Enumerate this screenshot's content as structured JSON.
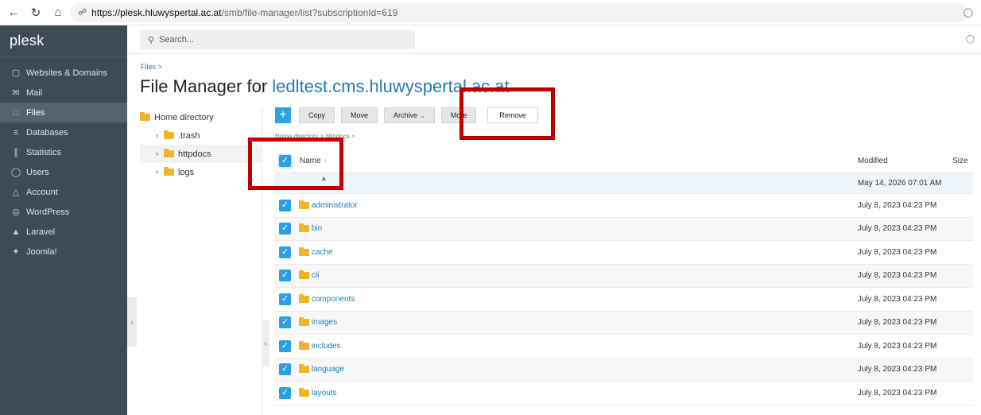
{
  "browser": {
    "url_host": "https://plesk.hluwyspertal.ac.at",
    "url_path": "/smb/file-manager/list?subscriptionId=619"
  },
  "sidebar": {
    "logo": "plesk",
    "items": [
      {
        "label": "Websites & Domains",
        "icon": "monitor-icon"
      },
      {
        "label": "Mail",
        "icon": "mail-icon"
      },
      {
        "label": "Files",
        "icon": "files-icon",
        "active": true
      },
      {
        "label": "Databases",
        "icon": "database-icon"
      },
      {
        "label": "Statistics",
        "icon": "statistics-icon"
      },
      {
        "label": "Users",
        "icon": "users-icon"
      },
      {
        "label": "Account",
        "icon": "account-icon"
      },
      {
        "label": "WordPress",
        "icon": "wordpress-icon"
      },
      {
        "label": "Laravel",
        "icon": "laravel-icon"
      },
      {
        "label": "Joomla!",
        "icon": "joomla-icon"
      }
    ]
  },
  "search": {
    "placeholder": "Search..."
  },
  "breadcrumb": {
    "root": "Files",
    "sep": ">"
  },
  "page": {
    "title_prefix": "File Manager for ",
    "title_domain": "ledltest.cms.hluwyspertal.ac.at"
  },
  "tree": {
    "root": "Home directory",
    "children": [
      ".trash",
      "httpdocs",
      "logs"
    ],
    "selected": "httpdocs"
  },
  "toolbar": {
    "copy": "Copy",
    "move": "Move",
    "archive": "Archive",
    "more": "More",
    "remove": "Remove"
  },
  "path_crumb": "Home directory > httpdocs >",
  "table": {
    "headers": {
      "name": "Name",
      "modified": "Modified",
      "size": "Size"
    },
    "parent_modified": "May 14, 2026 07:01 AM",
    "rows": [
      {
        "name": "administrator",
        "modified": "July 8, 2023 04:23 PM"
      },
      {
        "name": "bin",
        "modified": "July 8, 2023 04:23 PM"
      },
      {
        "name": "cache",
        "modified": "July 8, 2023 04:23 PM"
      },
      {
        "name": "cli",
        "modified": "July 8, 2023 04:23 PM"
      },
      {
        "name": "components",
        "modified": "July 8, 2023 04:23 PM"
      },
      {
        "name": "images",
        "modified": "July 8, 2023 04:23 PM"
      },
      {
        "name": "includes",
        "modified": "July 8, 2023 04:23 PM"
      },
      {
        "name": "language",
        "modified": "July 8, 2023 04:23 PM"
      },
      {
        "name": "layouts",
        "modified": "July 8, 2023 04:23 PM"
      }
    ]
  },
  "colors": {
    "sidebar": "#3d4a57",
    "accent": "#2b9fe0",
    "link": "#1f7bb6",
    "annotation": "#c00000"
  }
}
